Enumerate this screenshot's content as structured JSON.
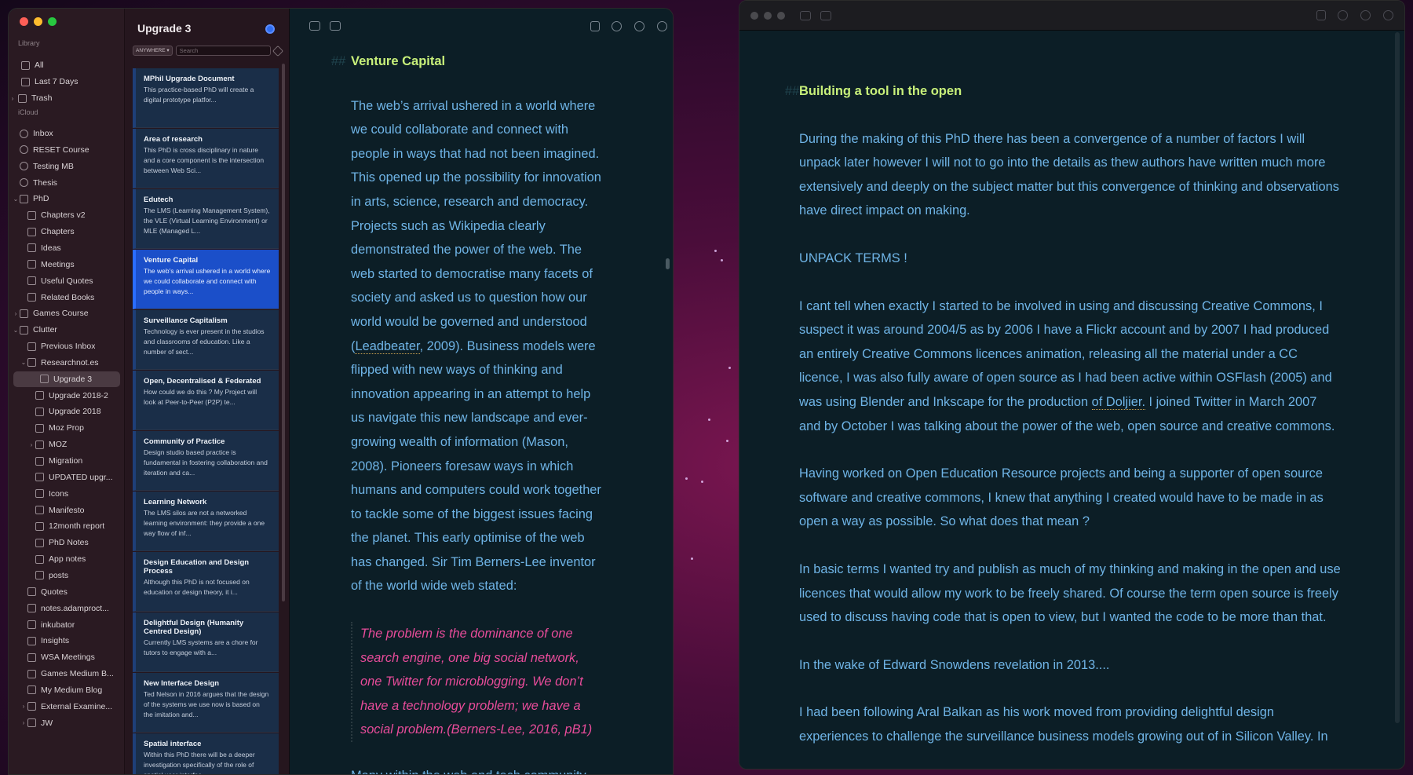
{
  "sidebar": {
    "library_title": "Library",
    "library": [
      {
        "label": "All",
        "icon": "documents-icon"
      },
      {
        "label": "Last 7 Days",
        "icon": "clock-icon"
      },
      {
        "label": "Trash",
        "icon": "trash-icon"
      }
    ],
    "icloud_title": "iCloud",
    "icloud": [
      {
        "label": "Inbox"
      },
      {
        "label": "RESET Course"
      },
      {
        "label": "Testing MB"
      },
      {
        "label": "Thesis"
      },
      {
        "label": "PhD"
      },
      {
        "label": "Chapters v2"
      },
      {
        "label": "Chapters"
      },
      {
        "label": "Ideas"
      },
      {
        "label": "Meetings"
      },
      {
        "label": "Useful Quotes"
      },
      {
        "label": "Related Books"
      },
      {
        "label": "Games Course"
      },
      {
        "label": "Clutter"
      },
      {
        "label": "Previous Inbox"
      },
      {
        "label": "Researchnot.es"
      },
      {
        "label": "Upgrade 3"
      },
      {
        "label": "Upgrade 2018-2"
      },
      {
        "label": "Upgrade 2018"
      },
      {
        "label": "Moz Prop"
      },
      {
        "label": "MOZ"
      },
      {
        "label": "Migration"
      },
      {
        "label": "UPDATED upgr..."
      },
      {
        "label": "Icons"
      },
      {
        "label": "Manifesto"
      },
      {
        "label": "12month report"
      },
      {
        "label": "PhD Notes"
      },
      {
        "label": "App notes"
      },
      {
        "label": "posts"
      },
      {
        "label": "Quotes"
      },
      {
        "label": "notes.adamproct..."
      },
      {
        "label": "inkubator"
      },
      {
        "label": "Insights"
      },
      {
        "label": "WSA Meetings"
      },
      {
        "label": "Games Medium B..."
      },
      {
        "label": "My Medium Blog"
      },
      {
        "label": "External Examine..."
      },
      {
        "label": "JW"
      }
    ]
  },
  "notelist": {
    "title": "Upgrade 3",
    "scope": "ANYWHERE ▾",
    "search_placeholder": "Search",
    "notes": [
      {
        "title": "MPhil Upgrade Document",
        "preview": "This practice-based PhD will create a digital prototype platfor..."
      },
      {
        "title": "Area of research",
        "preview": "This PhD is cross disciplinary in nature and a core component is the intersection between Web Sci..."
      },
      {
        "title": "Edutech",
        "preview": "The LMS (Learning Management System), the VLE (Virtual Learning Environment) or MLE (Managed L..."
      },
      {
        "title": "Venture Capital",
        "preview": "The web's arrival ushered in a world where we could collaborate and connect with people in ways..."
      },
      {
        "title": "Surveillance Capitalism",
        "preview": "Technology is ever present in the studios and classrooms of education. Like a number of sect..."
      },
      {
        "title": "Open, Decentralised & Federated",
        "preview": "How could we do this ? My Project will look at Peer-to-Peer (P2P) te..."
      },
      {
        "title": "Community of Practice",
        "preview": "Design studio based practice is fundamental in fostering collaboration and iteration and ca..."
      },
      {
        "title": "Learning Network",
        "preview": "The LMS silos are not a networked learning environment: they provide a one way flow of inf..."
      },
      {
        "title": "Design Education and Design Process",
        "preview": "Although this PhD is not focused on education or design theory, it i..."
      },
      {
        "title": "Delightful Design (Humanity Centred Design)",
        "preview": "Currently LMS systems are a chore for tutors to engage with a..."
      },
      {
        "title": "New Interface Design",
        "preview": "Ted Nelson in 2016 argues that the design of the systems we use now is based on the imitation and..."
      },
      {
        "title": "Spatial interface",
        "preview": "Within this PhD there will be a deeper investigation specifically of the role of spatial user interfac..."
      }
    ]
  },
  "editor1": {
    "hash": "##",
    "heading": "Venture Capital",
    "para_start": "The web’s arrival ushered in a world where we could collaborate and connect with people in ways that had not been imagined. This opened up the possibility for innovation in arts, science, research and democracy. Projects such as Wikipedia clearly demonstrated the power of the web. The web started to democratise many facets of society and asked us to question how our world would be governed and understood (",
    "para_link": "Leadbeater",
    "para_end": ", 2009). Business models were flipped with new ways of thinking and innovation appearing in an attempt to help us navigate this new landscape and ever-growing wealth of information (Mason, 2008). Pioneers foresaw ways in which humans and computers could work together to tackle some of the biggest issues facing the planet. This early optimise of the web has changed. Sir Tim Berners-Lee inventor of the world wide web stated:",
    "quote": "The problem is the dominance of one search engine, one big social network, one Twitter for microblogging. We don’t have a technology problem; we have a social problem.(Berners-Lee, 2016, pB1)",
    "cut": "Many within the web and tech community"
  },
  "editor2": {
    "hash": "##",
    "heading": "Building a tool in the open",
    "p1": "During the making of this PhD there has been a convergence of a number of factors I will unpack later however I will not to go into the details as thew authors have written much more extensively and deeply on the subject matter but this convergence of thinking and observations have direct impact on making.",
    "p2": "UNPACK TERMS !",
    "p3_start": "I cant tell when exactly I started to be involved in using and discussing Creative Commons, I suspect it was around 2004/5 as by 2006 I have a Flickr account and by 2007 I had produced an entirely Creative Commons licences animation, releasing all the material under a CC licence, I was also fully aware of open source as I had been active within OSFlash (2005) and was using Blender and Inkscape for the production ",
    "p3_link": "of Doljier.",
    "p3_end": " I joined Twitter in March 2007 and by October I was talking about the power of the web, open source and creative commons.",
    "p4": "Having worked on Open Education Resource projects and being a supporter of open source software and creative commons, I knew that anything I created would have to be made in as open a way as possible. So what does that mean ?",
    "p5": "In basic terms I wanted try and publish as much of my thinking and making in the open and use licences that would allow my work to be freely shared. Of course the term open source is freely used to discuss having code that is open to view, but I wanted the code to be more than that.",
    "p6": "In the wake of Edward Snowdens revelation in 2013....",
    "p7": "I had been following Aral Balkan as his work moved from providing delightful design experiences to challenge the surveillance business models growing out of in Silicon Valley. In"
  },
  "colors": {
    "heading": "#c8f07a",
    "body": "#6fb4e6",
    "quote": "#e84c9a",
    "selected_note": "#1b4fc9"
  }
}
